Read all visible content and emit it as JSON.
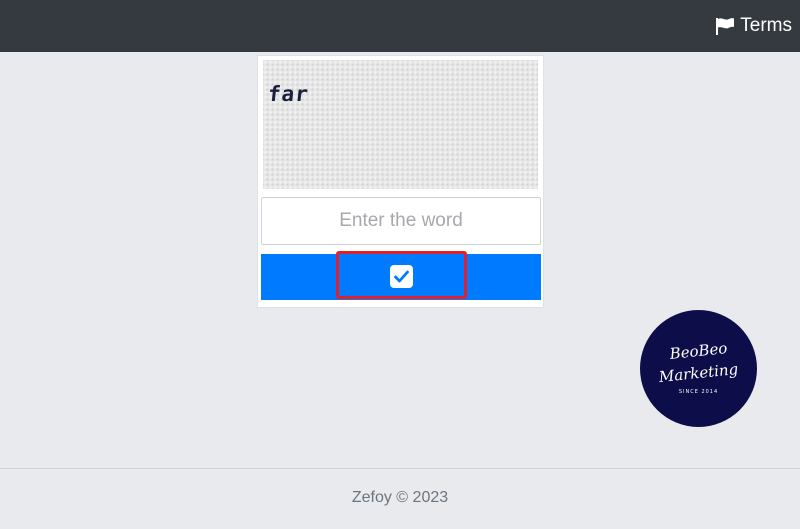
{
  "navbar": {
    "terms_label": "Terms",
    "terms_icon": "flag-icon"
  },
  "captcha": {
    "word": "far"
  },
  "form": {
    "input_value": "",
    "input_placeholder": "Enter the word",
    "submit_icon": "check-square-icon",
    "accent_color": "#007bff",
    "highlight_color": "#e3202a"
  },
  "badge": {
    "line1": "BeoBeo",
    "line2": "Marketing",
    "line3": "SINCE 2014",
    "background_color": "#0d0d4a"
  },
  "footer": {
    "text": "Zefoy © 2023"
  }
}
